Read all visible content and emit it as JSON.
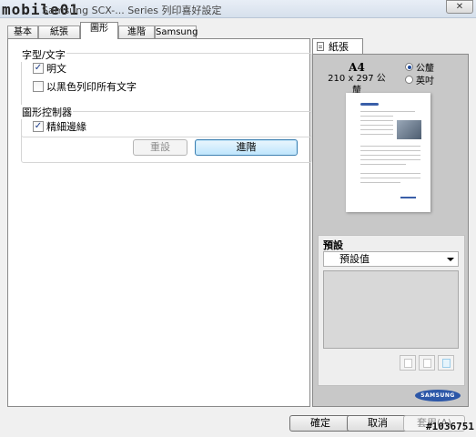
{
  "window": {
    "logo": "mobile01",
    "title": "Samsung SCX-... Series 列印喜好設定",
    "close_glyph": "✕"
  },
  "tabs": [
    "基本",
    "紙張",
    "圖形",
    "進階",
    "Samsung"
  ],
  "active_tab": "圖形",
  "graphics": {
    "font_group_title": "字型/文字",
    "checkbox_clear_text": "明文",
    "checkbox_clear_text_checked": true,
    "checkbox_all_text_black": "以黑色列印所有文字",
    "checkbox_all_text_black_checked": false,
    "controller_group_title": "圖形控制器",
    "checkbox_fine_edge": "精細邊緣",
    "checkbox_fine_edge_checked": true,
    "reset_button": "重設",
    "advanced_button": "進階"
  },
  "right_panel": {
    "tab_label": "紙張",
    "paper_size": "A4",
    "paper_dimensions": "210 x 297 公釐",
    "unit_mm": "公釐",
    "unit_inch": "英吋",
    "selected_unit": "公釐",
    "presets_label": "預設",
    "presets_value": "預設值",
    "brand": "SAMSUNG"
  },
  "footer": {
    "ok": "確定",
    "cancel": "取消",
    "apply": "套用(A)"
  },
  "watermark": "#1036751",
  "colors": {
    "selection_blue": "#3c7fb1",
    "brand_blue": "#2c57a8"
  }
}
